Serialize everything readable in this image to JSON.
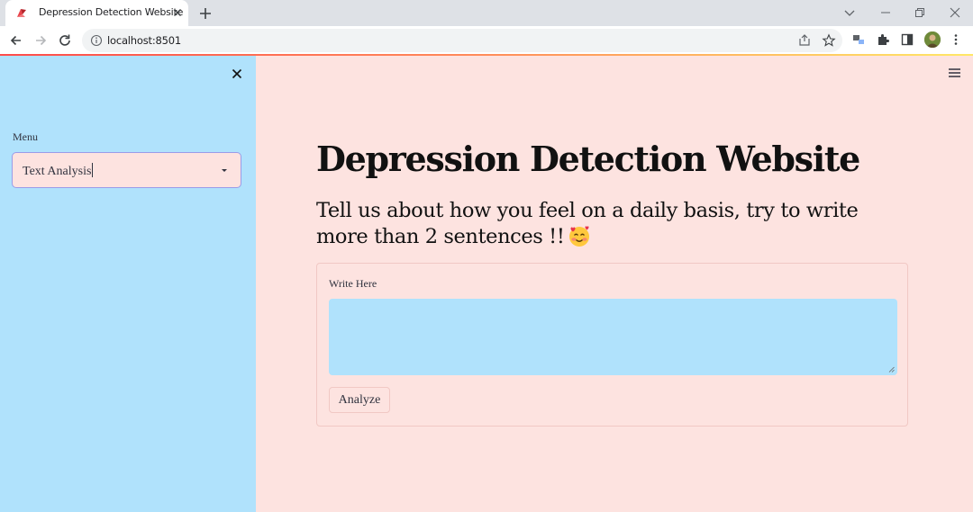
{
  "browser": {
    "tab_title": "Depression Detection Website",
    "url": "localhost:8501"
  },
  "sidebar": {
    "menu_label": "Menu",
    "selected_option": "Text Analysis"
  },
  "main": {
    "title": "Depression Detection Website",
    "subtitle": "Tell us about how you feel on a daily basis, try to write more than 2 sentences !!",
    "form": {
      "field_label": "Write Here",
      "textarea_value": "",
      "button_label": "Analyze"
    }
  },
  "colors": {
    "sidebar_bg": "#b0e2fc",
    "main_bg": "#fde3e0",
    "select_border": "#9a9be8"
  }
}
